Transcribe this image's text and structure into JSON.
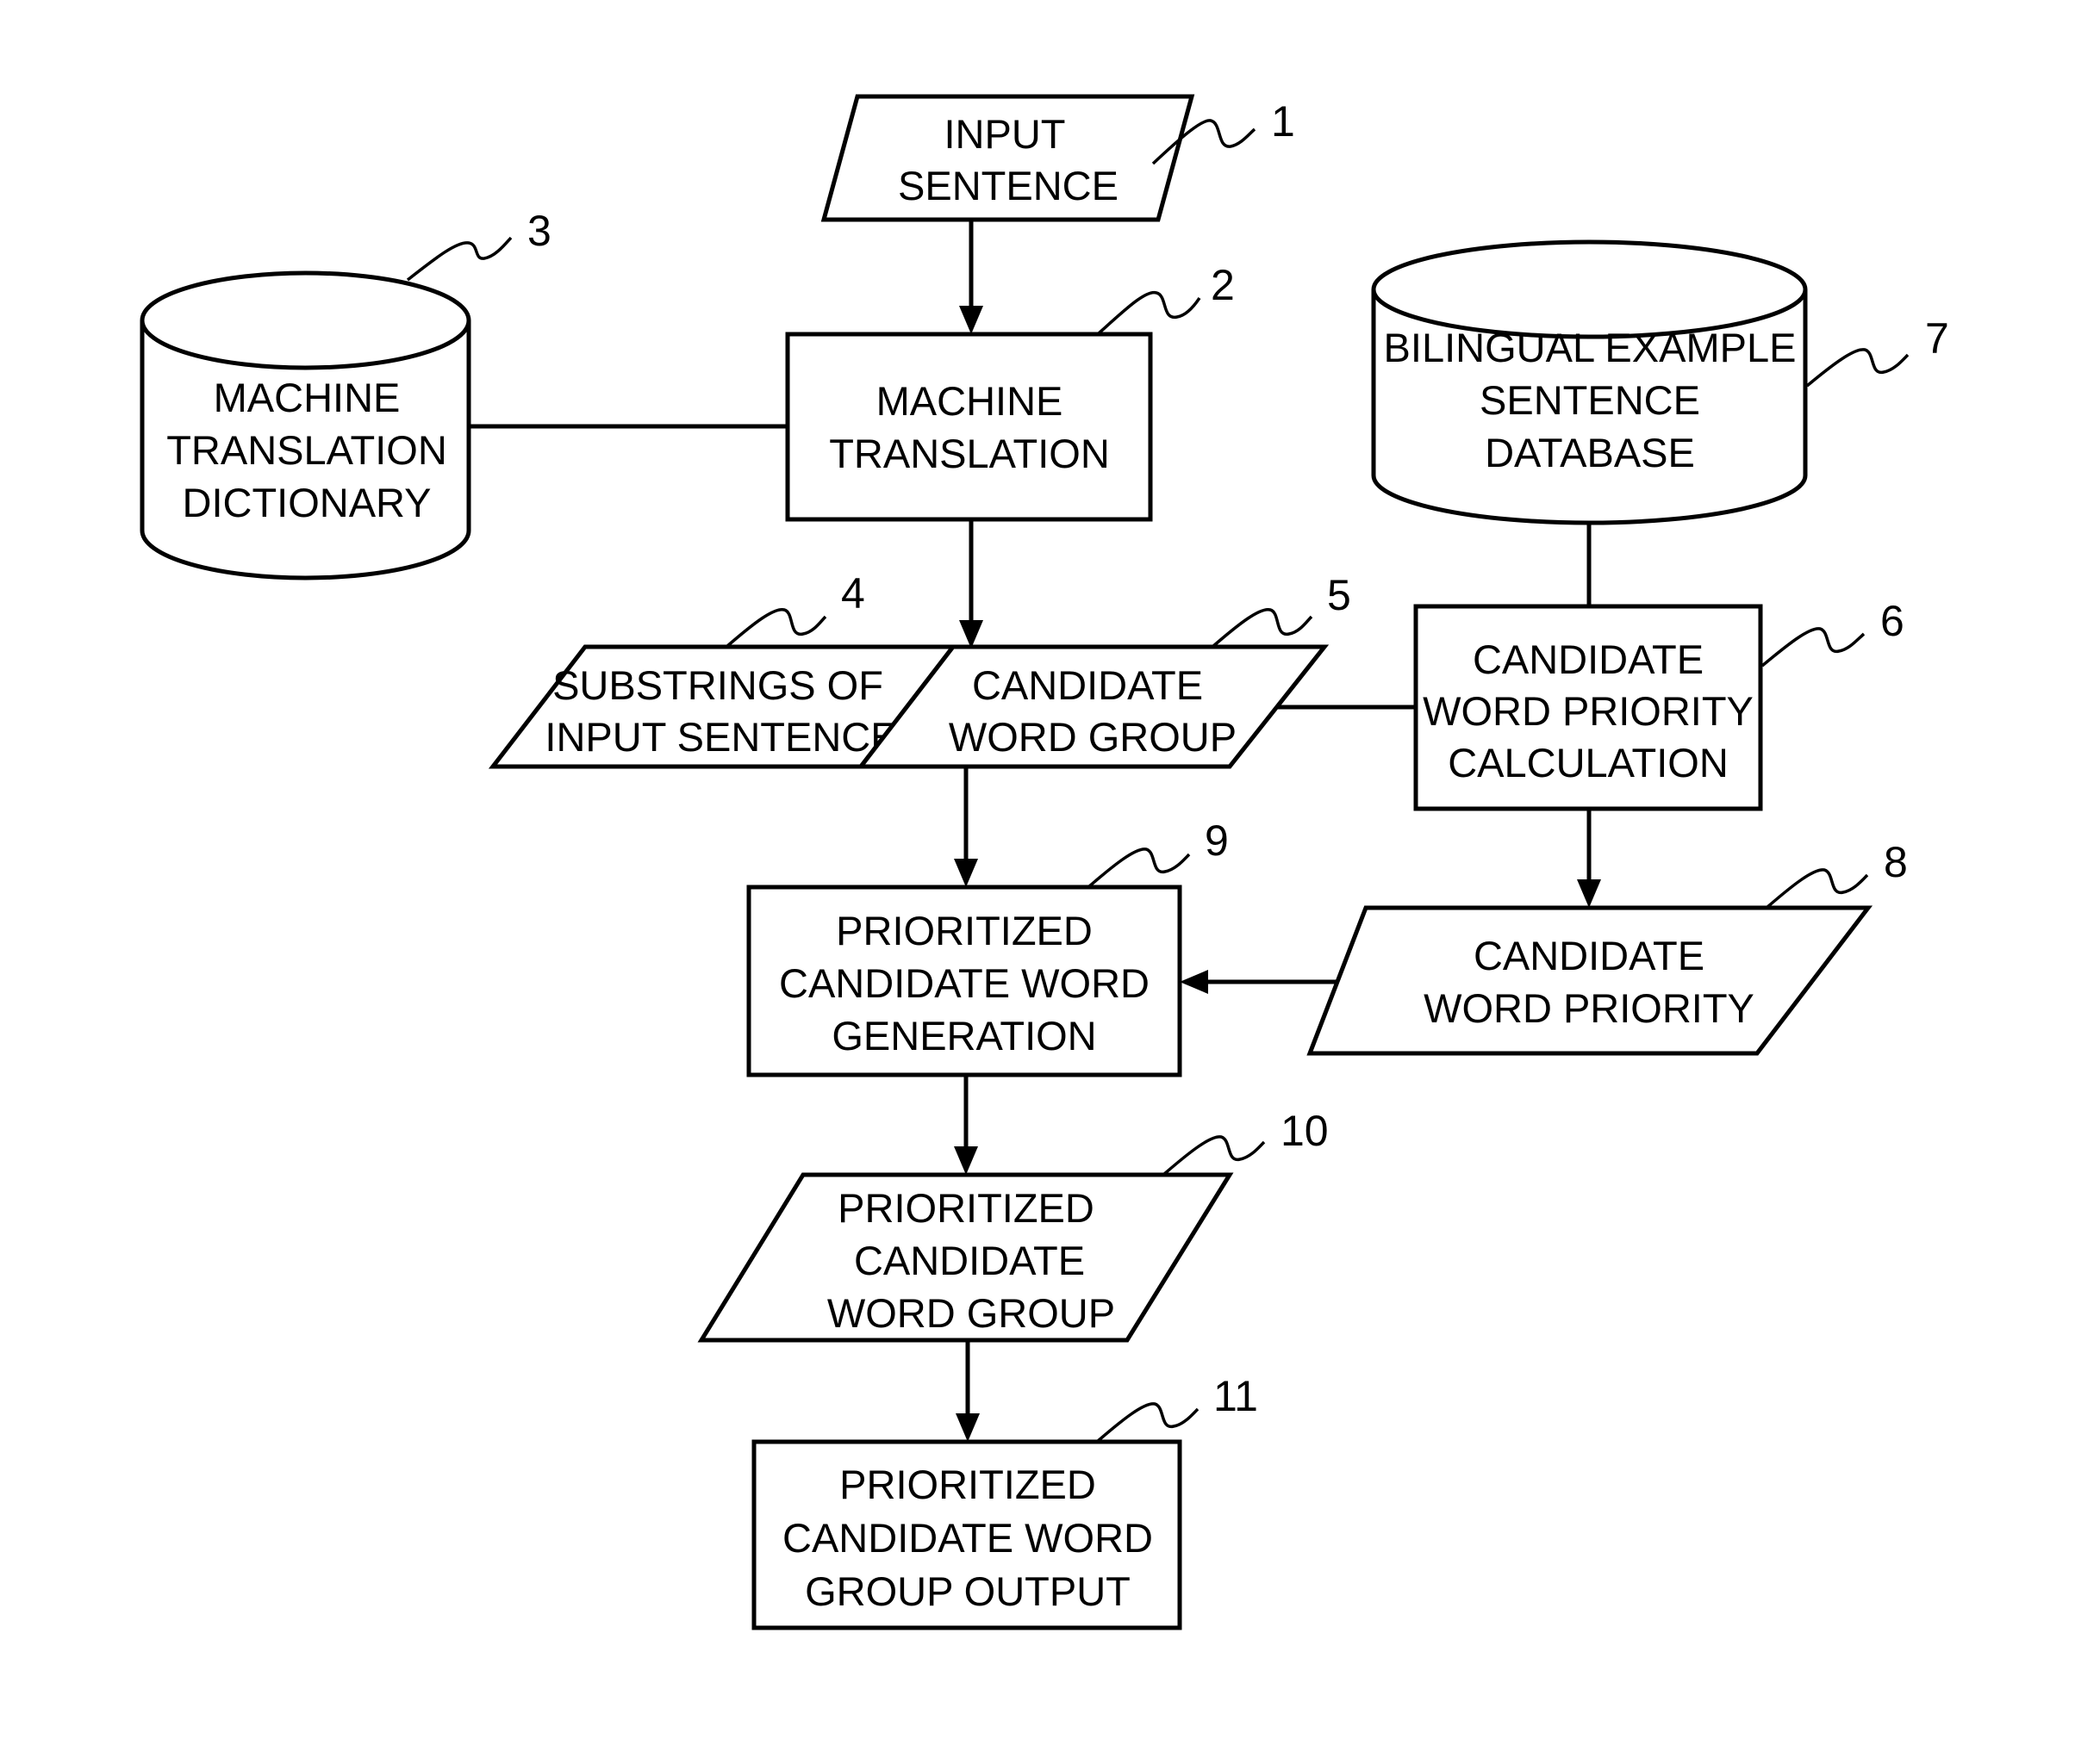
{
  "diagram": {
    "type": "flowchart",
    "colors": {
      "stroke": "#000000",
      "background": "#ffffff"
    },
    "nodes": [
      {
        "id": "1",
        "shape": "parallelogram",
        "lines": [
          "INPUT",
          "SENTENCE"
        ]
      },
      {
        "id": "2",
        "shape": "rectangle",
        "lines": [
          "MACHINE",
          "TRANSLATION"
        ]
      },
      {
        "id": "3",
        "shape": "cylinder",
        "lines": [
          "MACHINE",
          "TRANSLATION",
          "DICTIONARY"
        ]
      },
      {
        "id": "4",
        "shape": "parallelogram",
        "lines": [
          "SUBSTRINGS OF",
          "INPUT SENTENCE"
        ]
      },
      {
        "id": "5",
        "shape": "parallelogram",
        "lines": [
          "CANDIDATE",
          "WORD GROUP"
        ]
      },
      {
        "id": "6",
        "shape": "rectangle",
        "lines": [
          "CANDIDATE",
          "WORD PRIORITY",
          "CALCULATION"
        ]
      },
      {
        "id": "7",
        "shape": "cylinder",
        "lines": [
          "BILINGUAL EXAMPLE",
          "SENTENCE",
          "DATABASE"
        ]
      },
      {
        "id": "8",
        "shape": "parallelogram",
        "lines": [
          "CANDIDATE",
          "WORD PRIORITY"
        ]
      },
      {
        "id": "9",
        "shape": "rectangle",
        "lines": [
          "PRIORITIZED",
          "CANDIDATE WORD",
          "GENERATION"
        ]
      },
      {
        "id": "10",
        "shape": "parallelogram",
        "lines": [
          "PRIORITIZED",
          "CANDIDATE",
          "WORD GROUP"
        ]
      },
      {
        "id": "11",
        "shape": "rectangle",
        "lines": [
          "PRIORITIZED",
          "CANDIDATE WORD",
          "GROUP OUTPUT"
        ]
      }
    ],
    "edges": [
      {
        "from": "1",
        "to": "2",
        "arrow": true
      },
      {
        "from": "3",
        "to": "2",
        "arrow": false
      },
      {
        "from": "2",
        "to": "4-5",
        "arrow": true
      },
      {
        "from": "7",
        "to": "6",
        "arrow": false
      },
      {
        "from": "5",
        "to": "6",
        "arrow": false
      },
      {
        "from": "6",
        "to": "8",
        "arrow": true
      },
      {
        "from": "5",
        "to": "9",
        "arrow": true
      },
      {
        "from": "8",
        "to": "9",
        "arrow": true
      },
      {
        "from": "9",
        "to": "10",
        "arrow": true
      },
      {
        "from": "10",
        "to": "11",
        "arrow": true
      }
    ]
  }
}
